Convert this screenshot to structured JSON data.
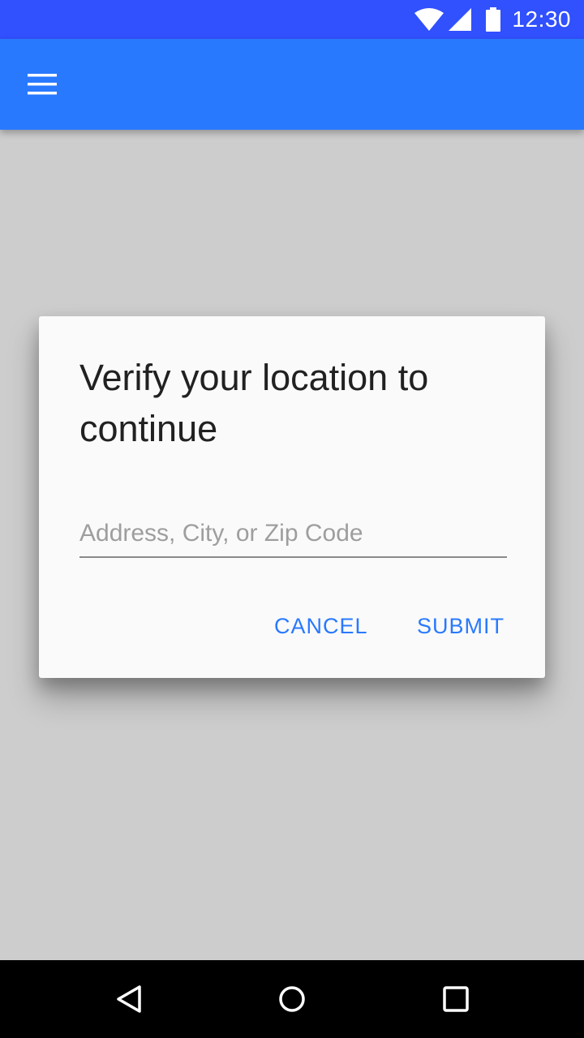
{
  "status_bar": {
    "time": "12:30",
    "background_color": "#3150fe",
    "icons": [
      "wifi-icon",
      "signal-icon",
      "battery-icon"
    ]
  },
  "app_bar": {
    "background_color": "#2979ff",
    "menu_icon": "menu-icon"
  },
  "dialog": {
    "title": "Verify your location to continue",
    "input": {
      "placeholder": "Address, City, or Zip Code",
      "value": ""
    },
    "actions": {
      "cancel_label": "CANCEL",
      "submit_label": "SUBMIT"
    },
    "accent_color": "#2979ff"
  },
  "nav_bar": {
    "icons": [
      "back-icon",
      "home-icon",
      "recents-icon"
    ]
  }
}
